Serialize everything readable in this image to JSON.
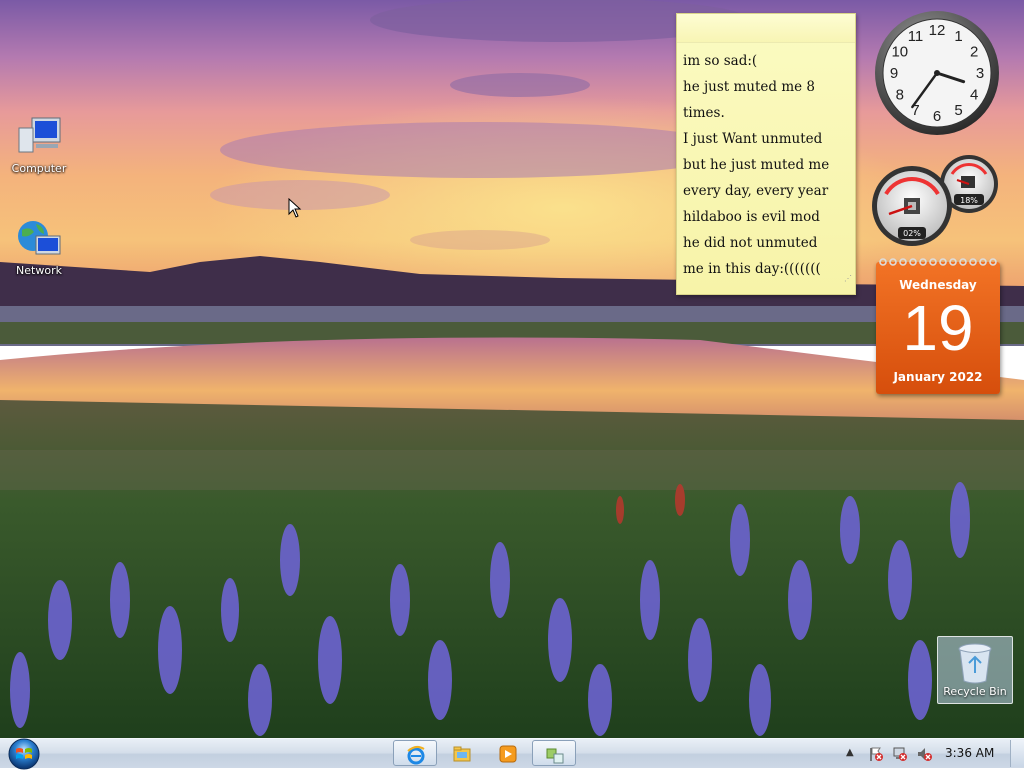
{
  "desktop": {
    "icons": [
      {
        "label": "Computer"
      },
      {
        "label": "Network"
      }
    ],
    "recycle_bin": {
      "label": "Recycle Bin"
    }
  },
  "sticky_note": {
    "lines": [
      "im so sad:(",
      "he just muted me 8",
      "times.",
      "I just Want unmuted",
      "but he just muted me",
      "every day, every year",
      "hildaboo is evil mod",
      "he did not unmuted",
      "me in this day:((((((("
    ]
  },
  "clock_gadget": {
    "time": "3:36",
    "numerals": [
      "12",
      "1",
      "2",
      "3",
      "4",
      "5",
      "6",
      "7",
      "8",
      "9",
      "10",
      "11"
    ]
  },
  "cpu_meter": {
    "cpu_percent": "02%",
    "memory_percent": "18%"
  },
  "calendar_gadget": {
    "weekday": "Wednesday",
    "day": "19",
    "month_year": "January 2022"
  },
  "taskbar": {
    "pinned": [
      {
        "icon": "internet-explorer-icon",
        "active": true
      },
      {
        "icon": "windows-explorer-icon",
        "active": false
      },
      {
        "icon": "media-player-icon",
        "active": false
      },
      {
        "icon": "gadgets-icon",
        "active": true
      }
    ],
    "clock": "3:36 AM"
  },
  "colors": {
    "calendar_orange": "#e8621b",
    "sticky_yellow": "#f9f6b3",
    "taskbar": "#d3dde9"
  }
}
